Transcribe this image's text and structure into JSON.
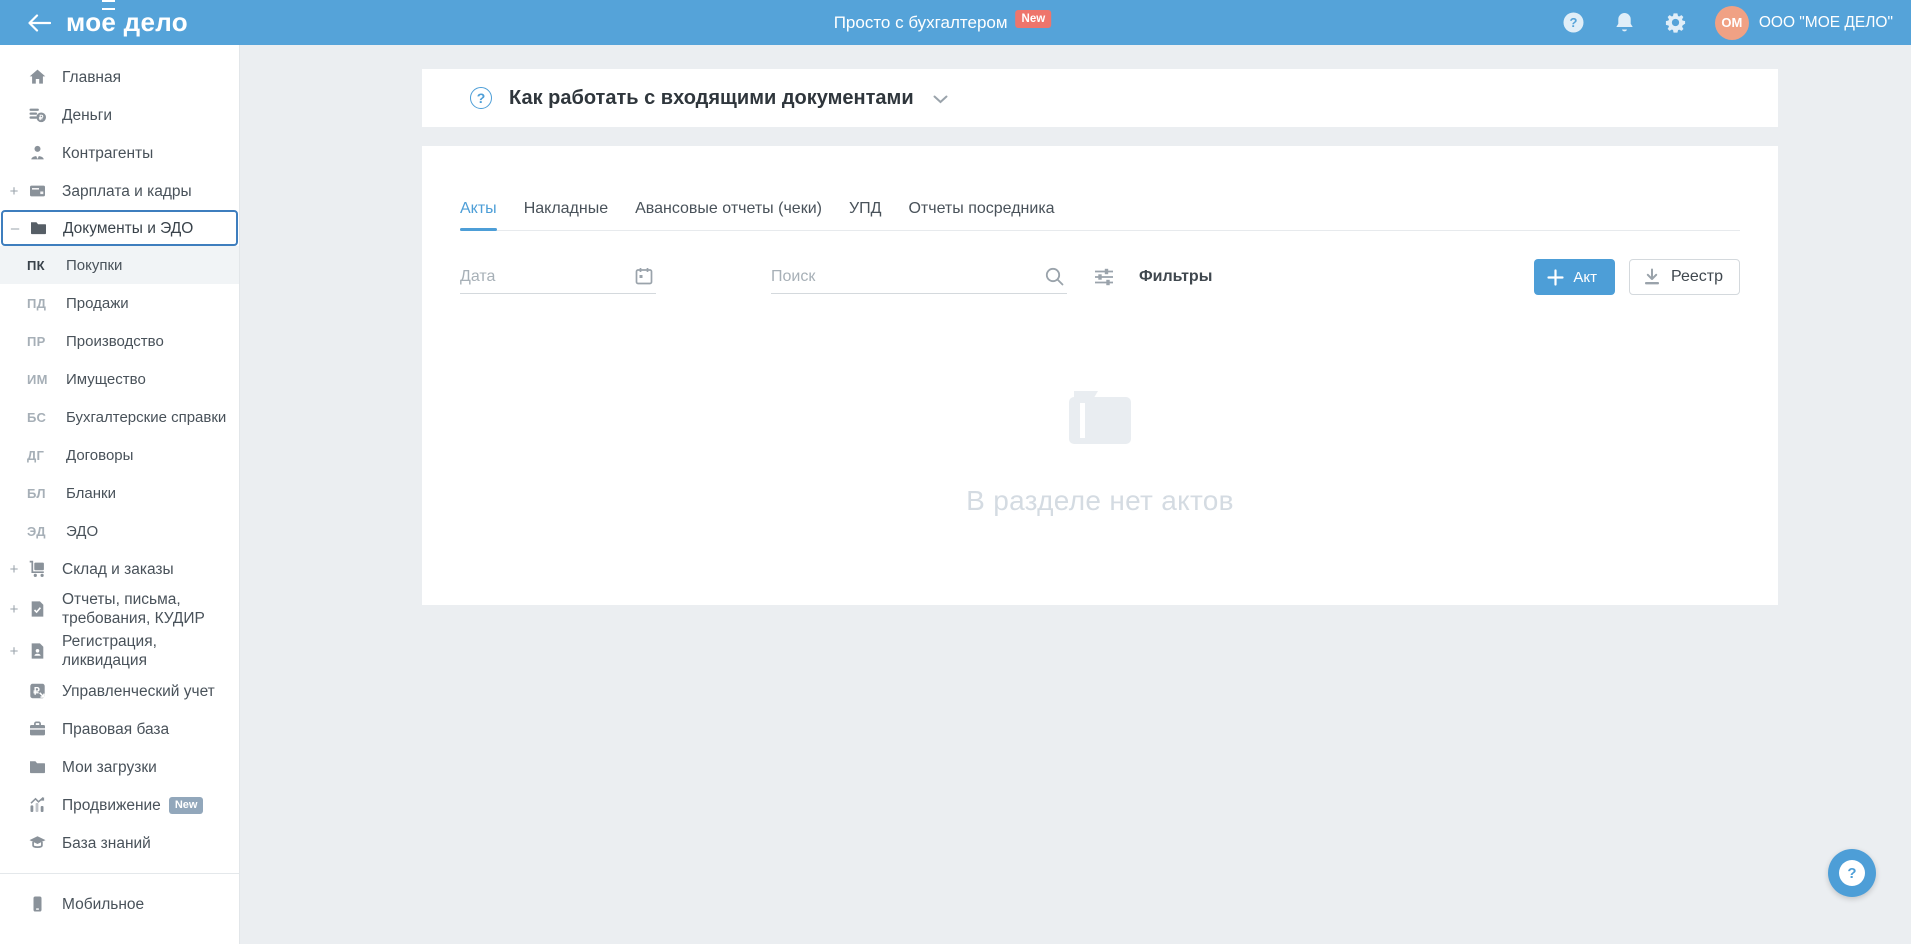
{
  "colors": {
    "header_blue": "#55A3D9",
    "accent_blue": "#4D9ED7",
    "selected_outline": "#3E7EBE",
    "new_badge_red": "#EE756C",
    "promo_badge_gray": "#92A7BB",
    "avatar_orange": "#F0A184",
    "empty_text_gray": "#D4DBE2"
  },
  "header": {
    "logo_prefix": "мо",
    "logo_e": "е",
    "logo_suffix": "дело",
    "tagline": "Просто с бухгалтером",
    "tagline_badge": "New",
    "avatar_initials": "ОМ",
    "company": "ООО \"МОЕ ДЕЛО\"",
    "icons": [
      "back-arrow-icon",
      "help-icon",
      "bell-icon",
      "gear-icon"
    ]
  },
  "sidebar": {
    "items": [
      {
        "id": "home",
        "label": "Главная",
        "icon": "home-icon"
      },
      {
        "id": "money",
        "label": "Деньги",
        "icon": "money-icon"
      },
      {
        "id": "contractors",
        "label": "Контрагенты",
        "icon": "contractors-icon"
      },
      {
        "id": "salary",
        "label": "Зарплата и кадры",
        "icon": "salary-card-icon",
        "expander": "+"
      },
      {
        "id": "documents",
        "label": "Документы и ЭДО",
        "icon": "folder-icon",
        "expander": "–",
        "selected": true
      },
      {
        "id": "purchases",
        "type": "sub",
        "code": "ПК",
        "label": "Покупки",
        "active": true
      },
      {
        "id": "sales",
        "type": "sub",
        "code": "ПД",
        "label": "Продажи"
      },
      {
        "id": "production",
        "type": "sub",
        "code": "ПР",
        "label": "Производство"
      },
      {
        "id": "property",
        "type": "sub",
        "code": "ИМ",
        "label": "Имущество"
      },
      {
        "id": "acc-certs",
        "type": "sub",
        "code": "БС",
        "label": "Бухгалтерские справки"
      },
      {
        "id": "contracts",
        "type": "sub",
        "code": "ДГ",
        "label": "Договоры"
      },
      {
        "id": "blanks",
        "type": "sub",
        "code": "БЛ",
        "label": "Бланки"
      },
      {
        "id": "edo",
        "type": "sub",
        "code": "ЭД",
        "label": "ЭДО"
      },
      {
        "id": "warehouse",
        "label": "Склад и заказы",
        "icon": "cart-icon",
        "expander": "+"
      },
      {
        "id": "reports",
        "label": "Отчеты, письма, требования, КУДИР",
        "icon": "report-doc-icon",
        "expander": "+"
      },
      {
        "id": "registration",
        "label": "Регистрация, ликвидация",
        "icon": "registration-doc-icon",
        "expander": "+"
      },
      {
        "id": "management",
        "label": "Управленческий учет",
        "icon": "management-ruble-icon"
      },
      {
        "id": "legal",
        "label": "Правовая база",
        "icon": "briefcase-icon"
      },
      {
        "id": "downloads",
        "label": "Мои загрузки",
        "icon": "uploads-folder-icon"
      },
      {
        "id": "promotion",
        "label": "Продвижение",
        "icon": "promotion-chart-icon",
        "badge": "New"
      },
      {
        "id": "knowledge",
        "label": "База знаний",
        "icon": "knowledge-cap-icon"
      },
      {
        "id": "mobile",
        "label": "Мобильное",
        "icon": "mobile-phone-icon",
        "divider_before": true
      }
    ]
  },
  "main": {
    "banner": {
      "title": "Как работать с входящими документами"
    },
    "tabs": [
      {
        "label": "Акты",
        "active": true
      },
      {
        "label": "Накладные"
      },
      {
        "label": "Авансовые отчеты (чеки)"
      },
      {
        "label": "УПД"
      },
      {
        "label": "Отчеты посредника"
      }
    ],
    "toolbar": {
      "date_placeholder": "Дата",
      "search_placeholder": "Поиск",
      "filters_label": "Фильтры",
      "add_button": "Акт",
      "registry_button": "Реестр"
    },
    "empty_state": {
      "message": "В разделе нет актов"
    }
  }
}
